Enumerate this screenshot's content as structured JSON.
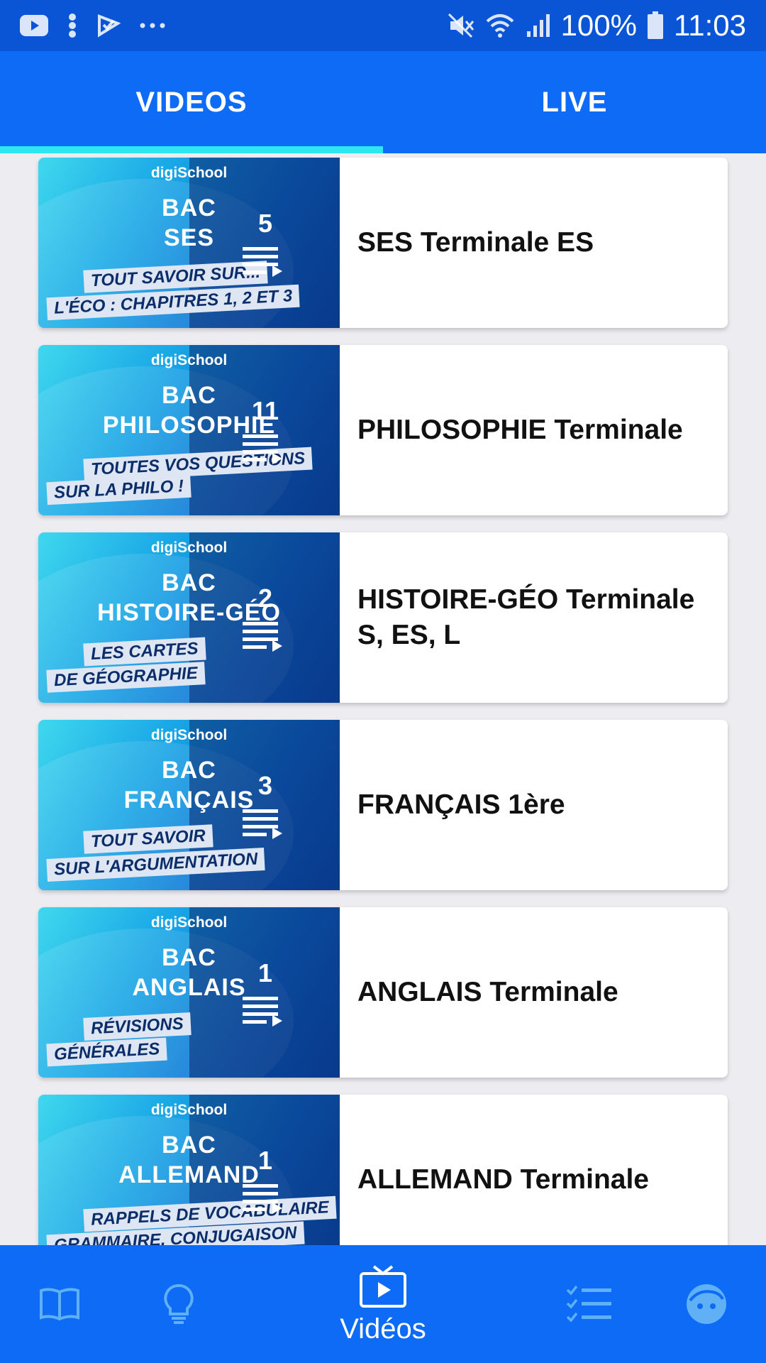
{
  "status_bar": {
    "icons": [
      "youtube-icon",
      "dots-vertical-icon",
      "check-flag-icon",
      "more-horizontal-icon",
      "mute-icon",
      "wifi-icon",
      "signal-icon",
      "battery-icon"
    ],
    "battery": "100%",
    "time": "11:03"
  },
  "tabs": [
    {
      "label": "VIDEOS",
      "active": true
    },
    {
      "label": "LIVE",
      "active": false
    }
  ],
  "brand": "digiSchool",
  "playlists": [
    {
      "thumb_line1": "BAC",
      "thumb_line2": "SES",
      "strip1": "TOUT SAVOIR SUR...",
      "strip2": "L'ÉCO : CHAPITRES 1, 2 ET 3",
      "count": "5",
      "title": "SES Terminale ES"
    },
    {
      "thumb_line1": "BAC",
      "thumb_line2": "PHILOSOPHIE",
      "strip1": "TOUTES VOS QUESTIONS",
      "strip2": "SUR LA PHILO !",
      "count": "11",
      "title": "PHILOSOPHIE Terminale"
    },
    {
      "thumb_line1": "BAC",
      "thumb_line2": "HISTOIRE-GÉO",
      "strip1": "LES CARTES",
      "strip2": "DE GÉOGRAPHIE",
      "count": "2",
      "title": "HISTOIRE-GÉO Terminale S, ES, L"
    },
    {
      "thumb_line1": "BAC",
      "thumb_line2": "FRANÇAIS",
      "strip1": "TOUT SAVOIR",
      "strip2": "SUR L'ARGUMENTATION",
      "count": "3",
      "title": "FRANÇAIS 1ère"
    },
    {
      "thumb_line1": "BAC",
      "thumb_line2": "ANGLAIS",
      "strip1": "RÉVISIONS",
      "strip2": "GÉNÉRALES",
      "count": "1",
      "title": "ANGLAIS Terminale"
    },
    {
      "thumb_line1": "BAC",
      "thumb_line2": "ALLEMAND",
      "strip1": "RAPPELS DE VOCABULAIRE",
      "strip2": "GRAMMAIRE, CONJUGAISON",
      "count": "1",
      "title": "ALLEMAND Terminale"
    }
  ],
  "bottom_nav": [
    {
      "icon": "book-icon",
      "label": ""
    },
    {
      "icon": "lightbulb-icon",
      "label": ""
    },
    {
      "icon": "tv-play-icon",
      "label": "Vidéos",
      "active": true
    },
    {
      "icon": "checklist-icon",
      "label": ""
    },
    {
      "icon": "face-icon",
      "label": ""
    }
  ],
  "colors": {
    "status_bar": "#0a55d6",
    "primary": "#0d6bf5",
    "tab_indicator": "#2ee6f0",
    "inactive_nav_icon": "#5fb0f5",
    "background": "#ececf1"
  }
}
